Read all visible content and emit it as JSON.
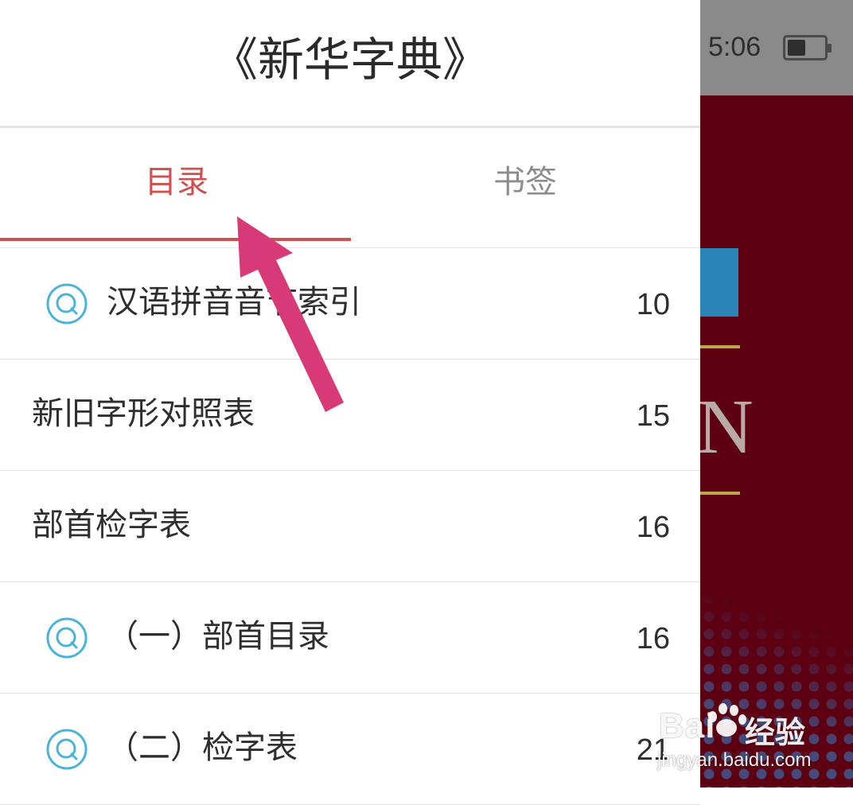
{
  "status_bar": {
    "time": "5:06"
  },
  "drawer": {
    "title": "《新华字典》",
    "tabs": [
      {
        "label": "目录",
        "active": true
      },
      {
        "label": "书签",
        "active": false
      }
    ],
    "toc_items": [
      {
        "label": "汉语拼音音节索引",
        "page": "10",
        "icon": "search-circle-icon"
      },
      {
        "label": "新旧字形对照表",
        "page": "15"
      },
      {
        "label": "部首检字表",
        "page": "16"
      },
      {
        "label": "（一）部首目录",
        "page": "16",
        "icon": "search-circle-icon"
      },
      {
        "label": "（二）检字表",
        "page": "21",
        "icon": "search-circle-icon"
      }
    ]
  },
  "background_app": {
    "cover_letter": "N"
  },
  "watermark": {
    "brand": "Bai",
    "brand_cn": "经验",
    "url": "jingyan.baidu.com"
  },
  "colors": {
    "accent": "#d0504f",
    "icon": "#4bb3d8",
    "arrow": "#d83a78",
    "cover": "#5c0012"
  }
}
